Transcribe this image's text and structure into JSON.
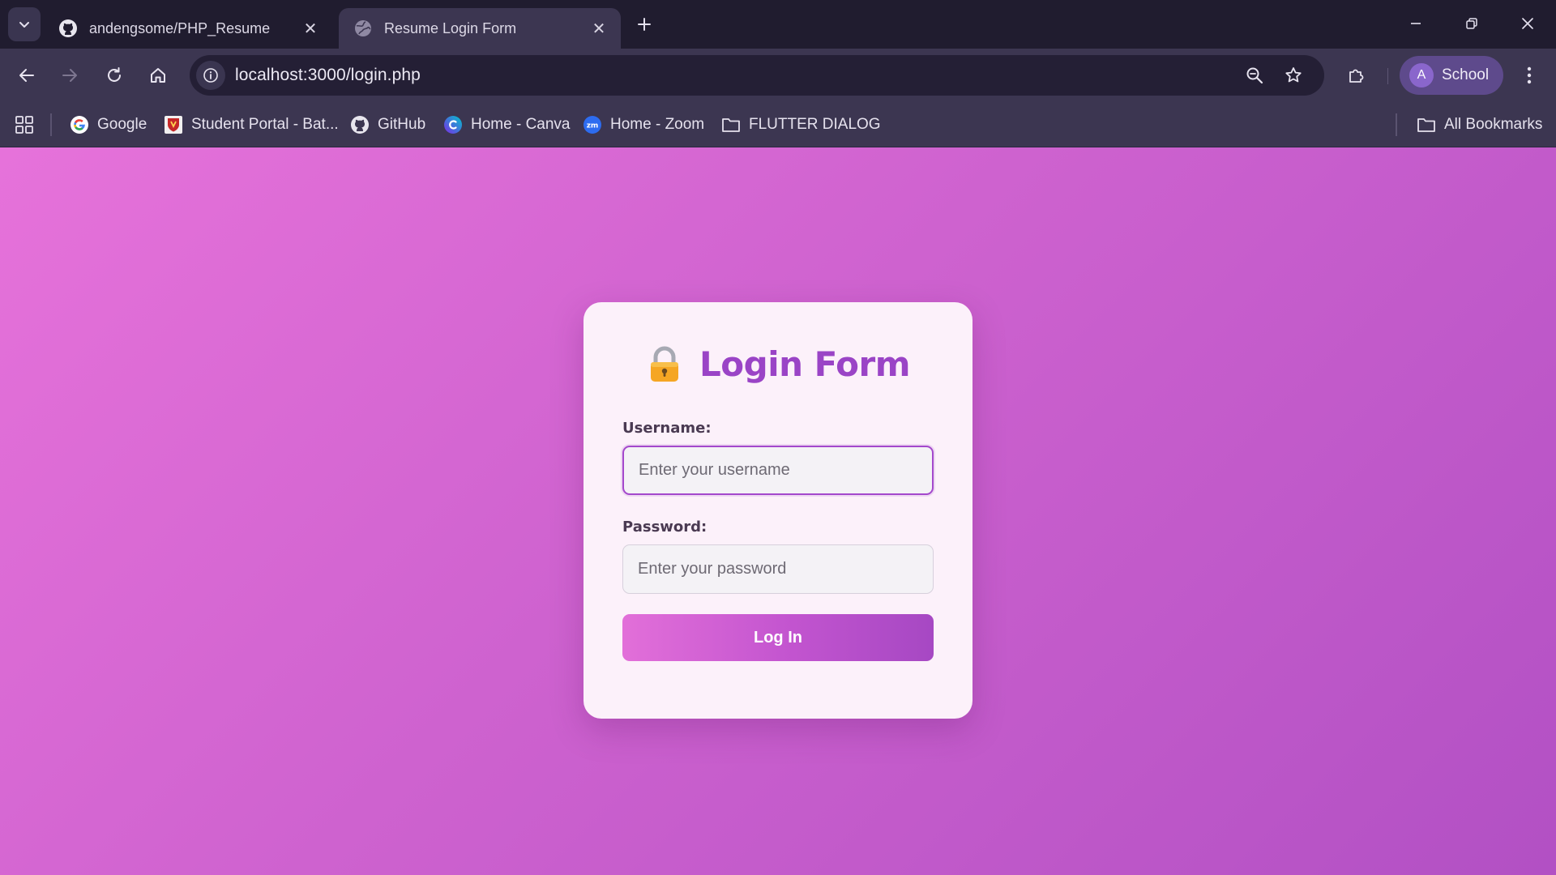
{
  "browser": {
    "tabs": [
      {
        "title": "andengsome/PHP_Resume",
        "icon": "github-icon",
        "active": false
      },
      {
        "title": "Resume Login Form",
        "icon": "globe-icon",
        "active": true
      }
    ],
    "url": "localhost:3000/login.php",
    "profile": {
      "initial": "A",
      "name": "School",
      "color": "#5e4a8c"
    },
    "bookmarks": [
      {
        "label": "Google",
        "icon": "google-icon"
      },
      {
        "label": "Student Portal - Bat...",
        "icon": "school-shield-icon"
      },
      {
        "label": "GitHub",
        "icon": "github-icon"
      },
      {
        "label": "Home - Canva",
        "icon": "canva-icon"
      },
      {
        "label": "Home - Zoom",
        "icon": "zoom-icon"
      },
      {
        "label": "FLUTTER DIALOG",
        "icon": "folder-icon"
      }
    ],
    "all_bookmarks_label": "All Bookmarks"
  },
  "login": {
    "title": "Login Form",
    "title_icon": "lock-icon",
    "username_label": "Username:",
    "username_placeholder": "Enter your username",
    "password_label": "Password:",
    "password_placeholder": "Enter your password",
    "submit_label": "Log In",
    "accent_color": "#9a44c6"
  }
}
